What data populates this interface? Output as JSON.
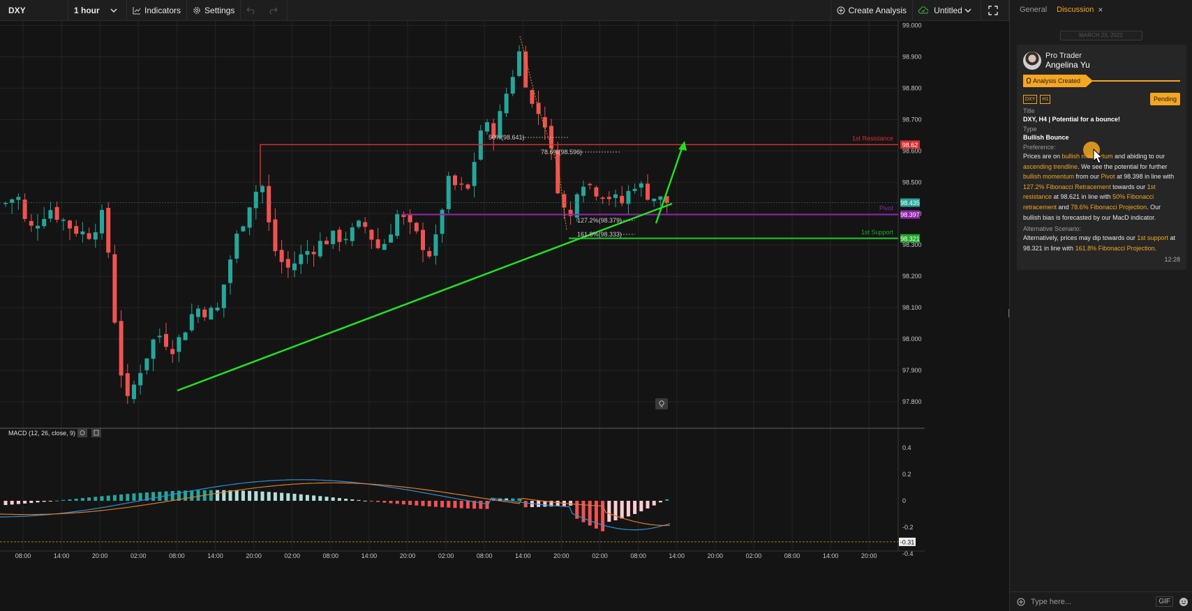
{
  "toolbar": {
    "symbol": "DXY",
    "interval": "1 hour",
    "indicators_label": "Indicators",
    "settings_label": "Settings",
    "create_analysis_label": "Create Analysis",
    "layout_label": "Untitled"
  },
  "chart": {
    "price_ticks": [
      "99.000",
      "98.900",
      "98.800",
      "98.700",
      "98.600",
      "98.500",
      "98.400",
      "98.300",
      "98.200",
      "98.100",
      "98.000",
      "97.900",
      "97.800"
    ],
    "time_ticks": [
      "08:00",
      "14:00",
      "20:00",
      "02:00",
      "08:00",
      "14:00",
      "20:00",
      "02:00",
      "08:00",
      "14:00",
      "20:00",
      "02:00",
      "08:00",
      "14:00",
      "20:00",
      "02:00",
      "08:00",
      "14:00",
      "20:00",
      "02:00",
      "08:00",
      "14:00",
      "20:00"
    ],
    "levels": {
      "resistance": {
        "label": "1st Resistance",
        "tag": "98.62",
        "price": 98.62,
        "color": "#d32f2f"
      },
      "pivot": {
        "label": "Pivot",
        "tag": "98.397",
        "price": 98.397,
        "color": "#8e24aa"
      },
      "support": {
        "label": "1st Support",
        "tag": "98.321",
        "price": 98.321,
        "color": "#1faa28"
      },
      "last": {
        "tag": "98.435",
        "price": 98.435,
        "color": "#26a69a"
      }
    },
    "fib_labels": [
      "50%(98.641)",
      "78.6%(98.596)",
      "127.2%(98.379)",
      "161.8%(98.333)"
    ],
    "colors": {
      "up": "#26a69a",
      "down": "#ef5350",
      "trend": "#22e022"
    }
  },
  "macd": {
    "title": "MACD (12, 26, close, 9)",
    "ticks": [
      "0.4",
      "0.2",
      "0",
      "-0.2",
      "-0.4"
    ],
    "value_tag": "-0.31"
  },
  "panel": {
    "tabs": {
      "general": "General",
      "discussion": "Discussion"
    },
    "date": "MARCH 23, 2022",
    "author": {
      "role": "Pro Trader",
      "name": "Angelina Yu"
    },
    "status": "Analysis Created",
    "badges": [
      "DXY",
      "H1"
    ],
    "pending": "Pending",
    "title_label": "Title",
    "title_value": "DXY, H4 | Potential for a bounce!",
    "type_label": "Type",
    "type_value": "Bullish Bounce",
    "preference_label": "Preference:",
    "preference_parts": [
      [
        "Prices are on ",
        false
      ],
      [
        "bullish momentum",
        true
      ],
      [
        " and abiding to our ",
        false
      ],
      [
        "ascending trendline",
        true
      ],
      [
        ". We see the potential for further ",
        false
      ],
      [
        "bullish momentum",
        true
      ],
      [
        " from our ",
        false
      ],
      [
        "Pivot",
        true
      ],
      [
        " at 98.398 in line with ",
        false
      ],
      [
        "127.2% Fibonacci Retracement",
        true
      ],
      [
        " towards our ",
        false
      ],
      [
        "1st resistance",
        true
      ],
      [
        " at 98.621 in line with ",
        false
      ],
      [
        "50% Fibonacci retracement",
        true
      ],
      [
        " and ",
        false
      ],
      [
        "78.6% Fibonacci Projection",
        true
      ],
      [
        ". Our bullish bias is forecasted by our MacD indicator.",
        false
      ]
    ],
    "alt_label": "Alternative Scenario:",
    "alt_parts": [
      [
        "Alternatively, prices may dip towards our ",
        false
      ],
      [
        "1st support",
        true
      ],
      [
        " at 98.321 in line with ",
        false
      ],
      [
        "161.8% Fibonacci Projection",
        true
      ],
      [
        ".",
        false
      ]
    ],
    "time": "12:28",
    "composer_placeholder": "Type here...",
    "gif_label": "GIF"
  }
}
